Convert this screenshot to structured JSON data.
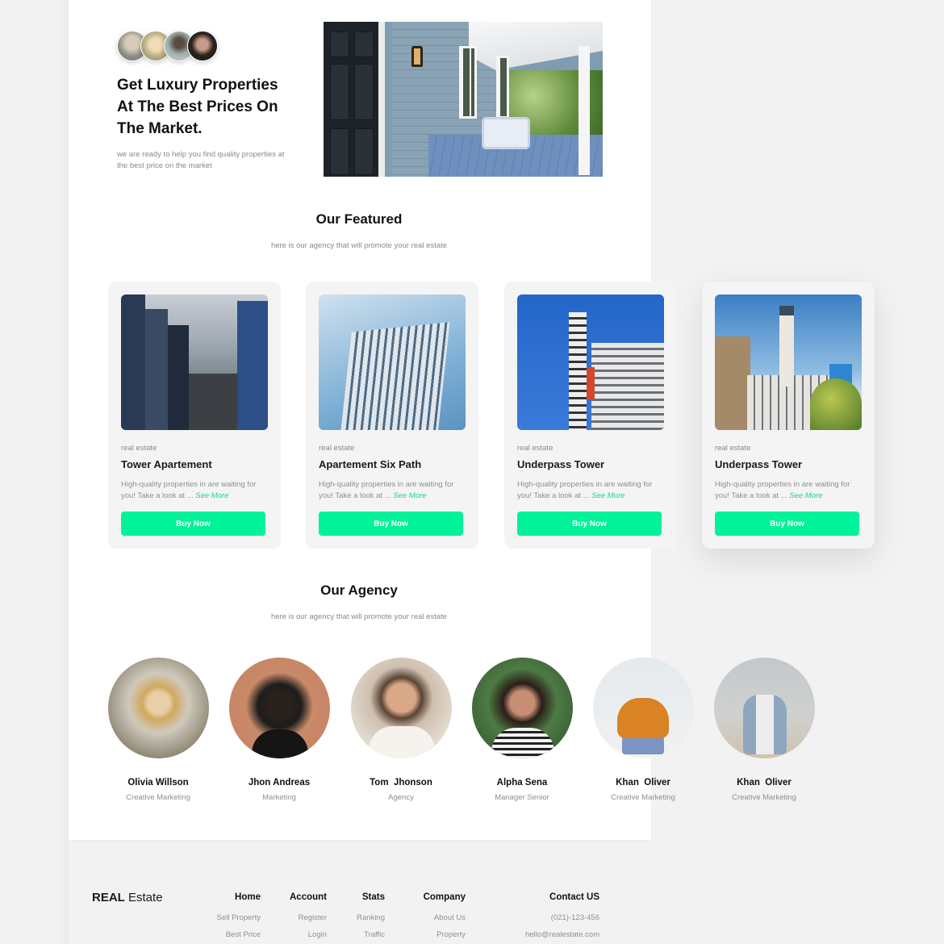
{
  "hero": {
    "avatars": [
      "avatar-1",
      "avatar-2",
      "avatar-3",
      "avatar-4"
    ],
    "title": "Get Luxury Properties At The Best Prices On The Market.",
    "subtitle": "we are ready to help you find quality properties at the best price  on the market"
  },
  "featured": {
    "title": "Our Featured",
    "subtitle": "here is our agency that will promote your real estate",
    "cards": [
      {
        "category": "real estate",
        "name": "Tower Apartement",
        "desc": "High-quality properties in  are waiting for you! Take a look at ... ",
        "more": "See More",
        "button": "Buy Now"
      },
      {
        "category": "real estate",
        "name": "Apartement Six Path",
        "desc": "High-quality properties in  are waiting for you! Take a look at ... ",
        "more": "See More",
        "button": "Buy Now"
      },
      {
        "category": "real estate",
        "name": "Underpass Tower",
        "desc": "High-quality properties in  are waiting for you! Take a look at ... ",
        "more": "See More",
        "button": "Buy Now"
      },
      {
        "category": "real estate",
        "name": "Underpass Tower",
        "desc": "High-quality properties in  are waiting for you! Take a look at ... ",
        "more": "See More",
        "button": "Buy Now"
      }
    ]
  },
  "agency": {
    "title": "Our Agency",
    "subtitle": "here is our agency that will promote your real estate",
    "agents": [
      {
        "name": "Olivia Willson",
        "role": "Creative Marketing"
      },
      {
        "name": "Jhon Andreas",
        "role": "Marketing"
      },
      {
        "name": "Tom  Jhonson",
        "role": "Agency"
      },
      {
        "name": "Alpha Sena",
        "role": "Manager Senior"
      },
      {
        "name": "Khan  Oliver",
        "role": "Creative Marketing"
      },
      {
        "name": "Khan  Oliver",
        "role": "Creative Marketing"
      }
    ]
  },
  "footer": {
    "logo_bold": "REAL",
    "logo_rest": " Estate",
    "columns": [
      {
        "heading": "Home",
        "links": [
          "Sell Property",
          "Best Price"
        ]
      },
      {
        "heading": "Account",
        "links": [
          "Register",
          "Login"
        ]
      },
      {
        "heading": "Stats",
        "links": [
          "Ranking",
          "Traffic"
        ]
      },
      {
        "heading": "Company",
        "links": [
          "About Us",
          "Property"
        ]
      },
      {
        "heading": "Contact US",
        "links": [
          "(021)-123-456",
          "hello@realestate.com"
        ]
      }
    ]
  },
  "colors": {
    "accent": "#00f29a",
    "link": "#12d98c",
    "card_bg": "#f4f4f4",
    "page_bg": "#f2f2f2"
  }
}
